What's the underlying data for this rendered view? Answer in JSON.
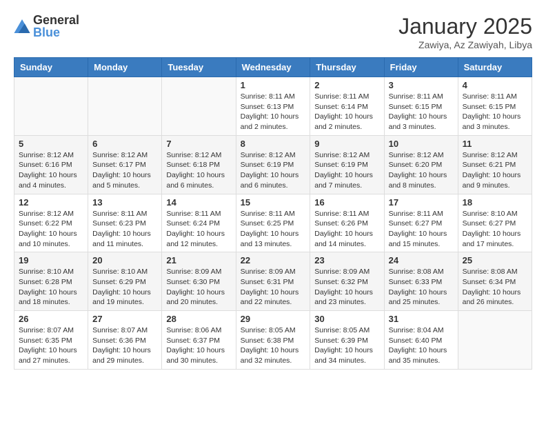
{
  "header": {
    "logo_general": "General",
    "logo_blue": "Blue",
    "title": "January 2025",
    "subtitle": "Zawiya, Az Zawiyah, Libya"
  },
  "weekdays": [
    "Sunday",
    "Monday",
    "Tuesday",
    "Wednesday",
    "Thursday",
    "Friday",
    "Saturday"
  ],
  "weeks": [
    [
      {
        "day": "",
        "info": ""
      },
      {
        "day": "",
        "info": ""
      },
      {
        "day": "",
        "info": ""
      },
      {
        "day": "1",
        "info": "Sunrise: 8:11 AM\nSunset: 6:13 PM\nDaylight: 10 hours\nand 2 minutes."
      },
      {
        "day": "2",
        "info": "Sunrise: 8:11 AM\nSunset: 6:14 PM\nDaylight: 10 hours\nand 2 minutes."
      },
      {
        "day": "3",
        "info": "Sunrise: 8:11 AM\nSunset: 6:15 PM\nDaylight: 10 hours\nand 3 minutes."
      },
      {
        "day": "4",
        "info": "Sunrise: 8:11 AM\nSunset: 6:15 PM\nDaylight: 10 hours\nand 3 minutes."
      }
    ],
    [
      {
        "day": "5",
        "info": "Sunrise: 8:12 AM\nSunset: 6:16 PM\nDaylight: 10 hours\nand 4 minutes."
      },
      {
        "day": "6",
        "info": "Sunrise: 8:12 AM\nSunset: 6:17 PM\nDaylight: 10 hours\nand 5 minutes."
      },
      {
        "day": "7",
        "info": "Sunrise: 8:12 AM\nSunset: 6:18 PM\nDaylight: 10 hours\nand 6 minutes."
      },
      {
        "day": "8",
        "info": "Sunrise: 8:12 AM\nSunset: 6:19 PM\nDaylight: 10 hours\nand 6 minutes."
      },
      {
        "day": "9",
        "info": "Sunrise: 8:12 AM\nSunset: 6:19 PM\nDaylight: 10 hours\nand 7 minutes."
      },
      {
        "day": "10",
        "info": "Sunrise: 8:12 AM\nSunset: 6:20 PM\nDaylight: 10 hours\nand 8 minutes."
      },
      {
        "day": "11",
        "info": "Sunrise: 8:12 AM\nSunset: 6:21 PM\nDaylight: 10 hours\nand 9 minutes."
      }
    ],
    [
      {
        "day": "12",
        "info": "Sunrise: 8:12 AM\nSunset: 6:22 PM\nDaylight: 10 hours\nand 10 minutes."
      },
      {
        "day": "13",
        "info": "Sunrise: 8:11 AM\nSunset: 6:23 PM\nDaylight: 10 hours\nand 11 minutes."
      },
      {
        "day": "14",
        "info": "Sunrise: 8:11 AM\nSunset: 6:24 PM\nDaylight: 10 hours\nand 12 minutes."
      },
      {
        "day": "15",
        "info": "Sunrise: 8:11 AM\nSunset: 6:25 PM\nDaylight: 10 hours\nand 13 minutes."
      },
      {
        "day": "16",
        "info": "Sunrise: 8:11 AM\nSunset: 6:26 PM\nDaylight: 10 hours\nand 14 minutes."
      },
      {
        "day": "17",
        "info": "Sunrise: 8:11 AM\nSunset: 6:27 PM\nDaylight: 10 hours\nand 15 minutes."
      },
      {
        "day": "18",
        "info": "Sunrise: 8:10 AM\nSunset: 6:27 PM\nDaylight: 10 hours\nand 17 minutes."
      }
    ],
    [
      {
        "day": "19",
        "info": "Sunrise: 8:10 AM\nSunset: 6:28 PM\nDaylight: 10 hours\nand 18 minutes."
      },
      {
        "day": "20",
        "info": "Sunrise: 8:10 AM\nSunset: 6:29 PM\nDaylight: 10 hours\nand 19 minutes."
      },
      {
        "day": "21",
        "info": "Sunrise: 8:09 AM\nSunset: 6:30 PM\nDaylight: 10 hours\nand 20 minutes."
      },
      {
        "day": "22",
        "info": "Sunrise: 8:09 AM\nSunset: 6:31 PM\nDaylight: 10 hours\nand 22 minutes."
      },
      {
        "day": "23",
        "info": "Sunrise: 8:09 AM\nSunset: 6:32 PM\nDaylight: 10 hours\nand 23 minutes."
      },
      {
        "day": "24",
        "info": "Sunrise: 8:08 AM\nSunset: 6:33 PM\nDaylight: 10 hours\nand 25 minutes."
      },
      {
        "day": "25",
        "info": "Sunrise: 8:08 AM\nSunset: 6:34 PM\nDaylight: 10 hours\nand 26 minutes."
      }
    ],
    [
      {
        "day": "26",
        "info": "Sunrise: 8:07 AM\nSunset: 6:35 PM\nDaylight: 10 hours\nand 27 minutes."
      },
      {
        "day": "27",
        "info": "Sunrise: 8:07 AM\nSunset: 6:36 PM\nDaylight: 10 hours\nand 29 minutes."
      },
      {
        "day": "28",
        "info": "Sunrise: 8:06 AM\nSunset: 6:37 PM\nDaylight: 10 hours\nand 30 minutes."
      },
      {
        "day": "29",
        "info": "Sunrise: 8:05 AM\nSunset: 6:38 PM\nDaylight: 10 hours\nand 32 minutes."
      },
      {
        "day": "30",
        "info": "Sunrise: 8:05 AM\nSunset: 6:39 PM\nDaylight: 10 hours\nand 34 minutes."
      },
      {
        "day": "31",
        "info": "Sunrise: 8:04 AM\nSunset: 6:40 PM\nDaylight: 10 hours\nand 35 minutes."
      },
      {
        "day": "",
        "info": ""
      }
    ]
  ]
}
